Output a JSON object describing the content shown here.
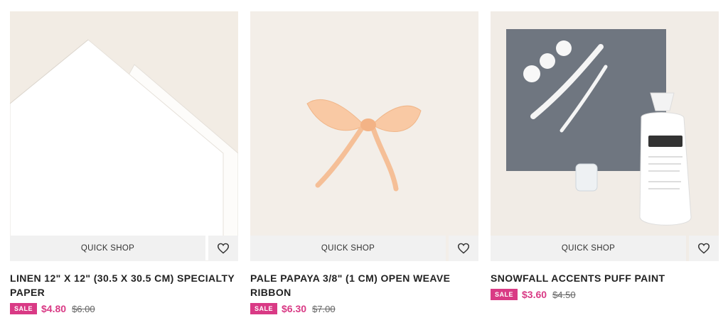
{
  "products": [
    {
      "title": "LINEN 12\" X 12\" (30.5 X 30.5 CM) SPECIALTY PAPER",
      "quick_shop_label": "QUICK SHOP",
      "sale_badge": "SALE",
      "price": "$4.80",
      "old_price": "$6.00",
      "wishlist_icon": "heart-outline-icon"
    },
    {
      "title": "PALE PAPAYA 3/8\" (1 CM) OPEN WEAVE RIBBON",
      "quick_shop_label": "QUICK SHOP",
      "sale_badge": "SALE",
      "price": "$6.30",
      "old_price": "$7.00",
      "wishlist_icon": "heart-outline-icon"
    },
    {
      "title": "SNOWFALL ACCENTS PUFF PAINT",
      "quick_shop_label": "QUICK SHOP",
      "sale_badge": "SALE",
      "price": "$3.60",
      "old_price": "$4.50",
      "wishlist_icon": "heart-outline-icon"
    }
  ],
  "colors": {
    "sale_pink": "#d93a85",
    "image_bg": "#f3eee8",
    "action_bg": "#f1f1f1"
  }
}
